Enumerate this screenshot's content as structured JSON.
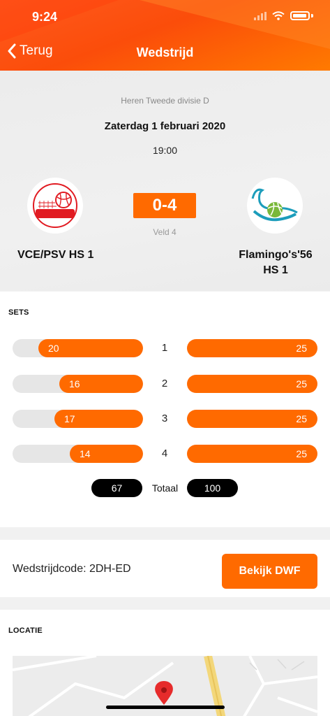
{
  "status": {
    "time": "9:24"
  },
  "nav": {
    "back_label": "Terug",
    "title": "Wedstrijd"
  },
  "match": {
    "competition": "Heren Tweede divisie D",
    "date": "Zaterdag 1 februari 2020",
    "time": "19:00",
    "score": "0-4",
    "field": "Veld 4",
    "home": {
      "name": "VCE/PSV HS 1",
      "logo_text": "VCE-PSV"
    },
    "away": {
      "name": "Flamingo's'56 HS 1",
      "logo_text": "Flamingo's 56"
    }
  },
  "sets": {
    "title": "SETS",
    "rows": [
      {
        "number": "1",
        "home": "20",
        "away": "25"
      },
      {
        "number": "2",
        "home": "16",
        "away": "25"
      },
      {
        "number": "3",
        "home": "17",
        "away": "25"
      },
      {
        "number": "4",
        "home": "14",
        "away": "25"
      }
    ],
    "total_label": "Totaal",
    "total_home": "67",
    "total_away": "100"
  },
  "code": {
    "label": "Wedstrijdcode: 2DH-ED",
    "button_label": "Bekijk DWF"
  },
  "location": {
    "title": "LOCATIE"
  },
  "colors": {
    "accent": "#ff6a00",
    "header": "#fb4d0a"
  }
}
